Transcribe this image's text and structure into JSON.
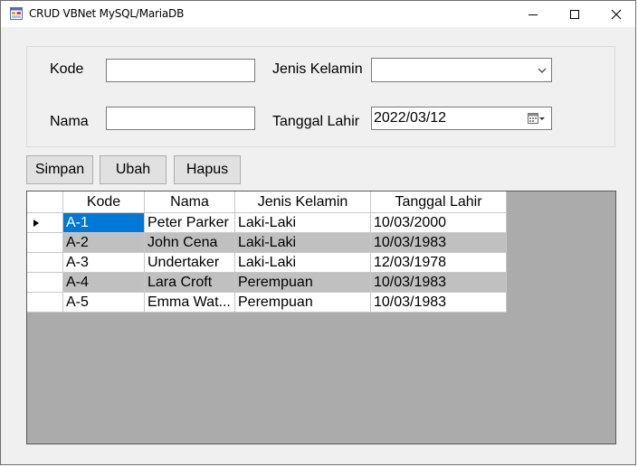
{
  "window": {
    "title": "CRUD VBNet MySQL/MariaDB"
  },
  "controls": {
    "minimize": "minimize-icon",
    "maximize": "maximize-icon",
    "close": "close-icon"
  },
  "form": {
    "kode_label": "Kode",
    "kode_value": "",
    "nama_label": "Nama",
    "nama_value": "",
    "jenis_kelamin_label": "Jenis Kelamin",
    "jenis_kelamin_value": "",
    "tanggal_lahir_label": "Tanggal Lahir",
    "tanggal_lahir_value": "2022/03/12"
  },
  "buttons": {
    "simpan": "Simpan",
    "ubah": "Ubah",
    "hapus": "Hapus"
  },
  "table": {
    "columns": [
      "Kode",
      "Nama",
      "Jenis Kelamin",
      "Tanggal Lahir"
    ],
    "rows": [
      [
        "A-1",
        "Peter Parker",
        "Laki-Laki",
        "10/03/2000"
      ],
      [
        "A-2",
        "John Cena",
        "Laki-Laki",
        "10/03/1983"
      ],
      [
        "A-3",
        "Undertaker",
        "Laki-Laki",
        "12/03/1978"
      ],
      [
        "A-4",
        "Lara Croft",
        "Perempuan",
        "10/03/1983"
      ],
      [
        "A-5",
        "Emma Wat...",
        "Perempuan",
        "10/03/1983"
      ]
    ],
    "selected_row": 0
  },
  "colors": {
    "selection": "#0078d7",
    "alt_row": "#c0c0c0",
    "grid_background": "#ababab"
  }
}
